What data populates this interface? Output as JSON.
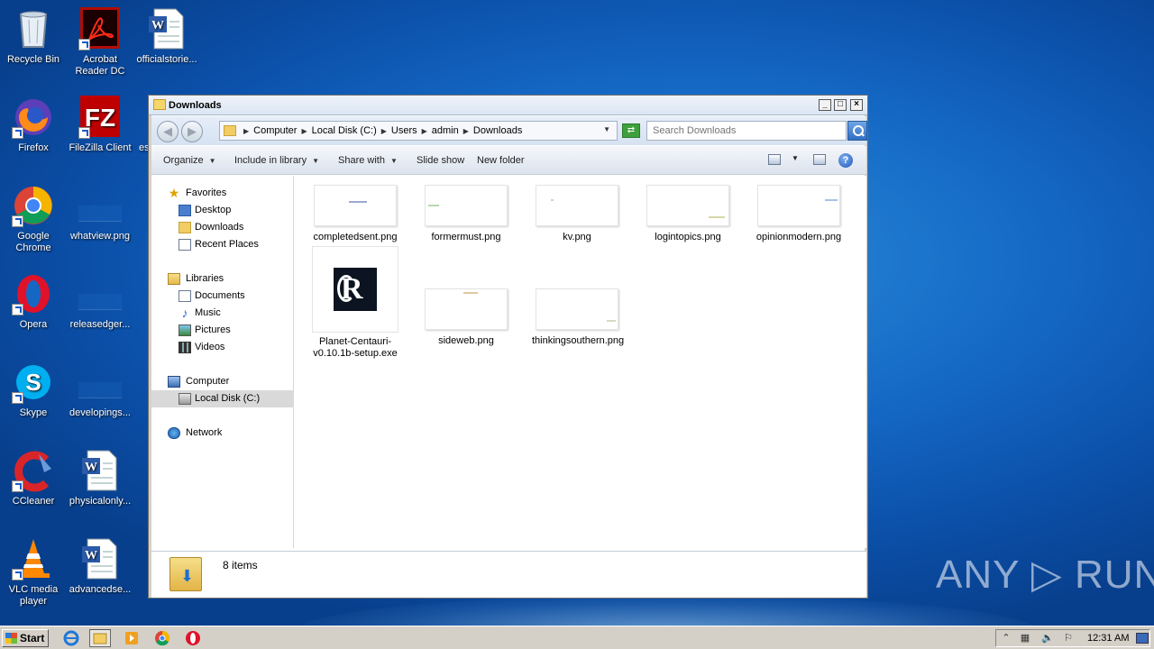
{
  "desktop": {
    "icons": [
      {
        "label": "Recycle Bin"
      },
      {
        "label": "Acrobat Reader DC"
      },
      {
        "label": "officialstorie..."
      },
      {
        "label": "Firefox"
      },
      {
        "label": "FileZilla Client"
      },
      {
        "label": "es"
      },
      {
        "label": "Google Chrome"
      },
      {
        "label": "whatview.png"
      },
      {
        "label": "Opera"
      },
      {
        "label": "releasedger..."
      },
      {
        "label": "Skype"
      },
      {
        "label": "developings..."
      },
      {
        "label": "CCleaner"
      },
      {
        "label": "physicalonly..."
      },
      {
        "label": "VLC media player"
      },
      {
        "label": "advancedse..."
      }
    ]
  },
  "window": {
    "title": "Downloads",
    "breadcrumbs": [
      "Computer",
      "Local Disk (C:)",
      "Users",
      "admin",
      "Downloads"
    ],
    "search_placeholder": "Search Downloads",
    "toolbar": {
      "organize": "Organize",
      "include_in_library": "Include in library",
      "share_with": "Share with",
      "slide_show": "Slide show",
      "new_folder": "New folder"
    },
    "nav": {
      "favorites": "Favorites",
      "desktop": "Desktop",
      "downloads": "Downloads",
      "recent_places": "Recent Places",
      "libraries": "Libraries",
      "documents": "Documents",
      "music": "Music",
      "pictures": "Pictures",
      "videos": "Videos",
      "computer": "Computer",
      "local_disk": "Local Disk (C:)",
      "network": "Network"
    },
    "files": [
      {
        "name": "completedsent.png"
      },
      {
        "name": "formermust.png"
      },
      {
        "name": "kv.png"
      },
      {
        "name": "logintopics.png"
      },
      {
        "name": "opinionmodern.png"
      },
      {
        "name": "Planet-Centauri-v0.10.1b-setup.exe"
      },
      {
        "name": "sideweb.png"
      },
      {
        "name": "thinkingsouthern.png"
      }
    ],
    "status": "8 items"
  },
  "taskbar": {
    "start": "Start",
    "clock": "12:31 AM"
  },
  "watermark": "ANY ▷ RUN"
}
